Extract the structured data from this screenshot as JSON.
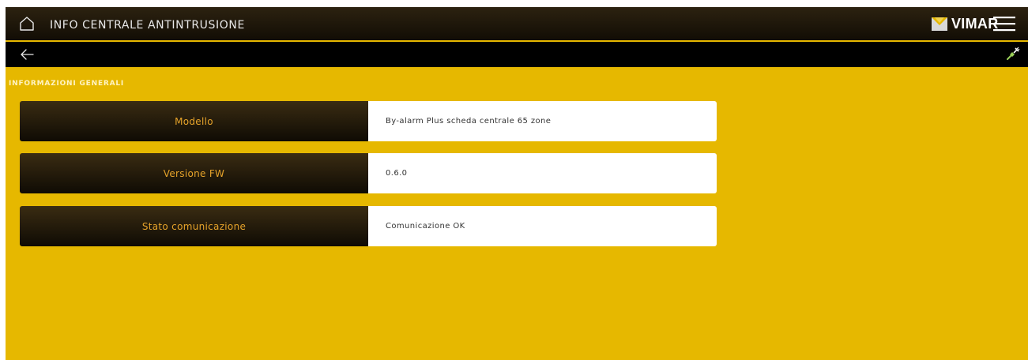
{
  "header": {
    "title": "INFO CENTRALE ANTINTRUSIONE",
    "brand": "VIMAR",
    "home_icon": "home-icon",
    "menu_icon": "hamburger-menu-icon"
  },
  "subbar": {
    "back_icon": "arrow-left-icon",
    "status_icon": "plug-connected-icon"
  },
  "section": {
    "title": "INFORMAZIONI GENERALI"
  },
  "rows": [
    {
      "label": "Modello",
      "value": "By-alarm Plus scheda centrale 65 zone"
    },
    {
      "label": "Versione FW",
      "value": "0.6.0"
    },
    {
      "label": "Stato comunicazione",
      "value": "Comunicazione OK"
    }
  ],
  "colors": {
    "background": "#e6b800",
    "header_dark": "#1a140a",
    "label_text": "#e6a32a",
    "value_bg": "#ffffff"
  }
}
